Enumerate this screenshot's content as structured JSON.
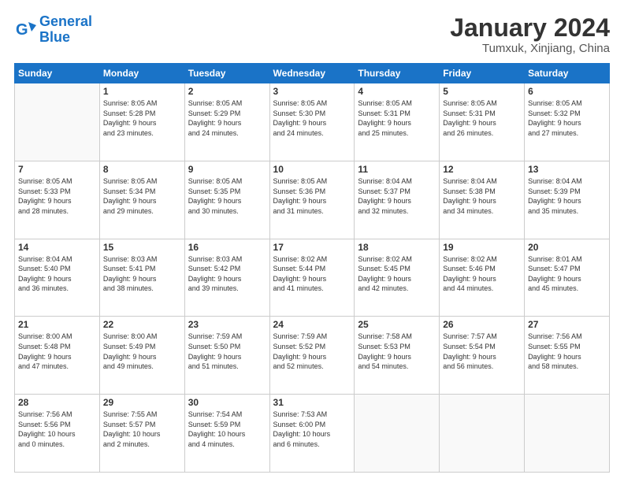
{
  "logo": {
    "line1": "General",
    "line2": "Blue"
  },
  "title": "January 2024",
  "subtitle": "Tumxuk, Xinjiang, China",
  "weekdays": [
    "Sunday",
    "Monday",
    "Tuesday",
    "Wednesday",
    "Thursday",
    "Friday",
    "Saturday"
  ],
  "weeks": [
    [
      {
        "day": "",
        "info": ""
      },
      {
        "day": "1",
        "info": "Sunrise: 8:05 AM\nSunset: 5:28 PM\nDaylight: 9 hours\nand 23 minutes."
      },
      {
        "day": "2",
        "info": "Sunrise: 8:05 AM\nSunset: 5:29 PM\nDaylight: 9 hours\nand 24 minutes."
      },
      {
        "day": "3",
        "info": "Sunrise: 8:05 AM\nSunset: 5:30 PM\nDaylight: 9 hours\nand 24 minutes."
      },
      {
        "day": "4",
        "info": "Sunrise: 8:05 AM\nSunset: 5:31 PM\nDaylight: 9 hours\nand 25 minutes."
      },
      {
        "day": "5",
        "info": "Sunrise: 8:05 AM\nSunset: 5:31 PM\nDaylight: 9 hours\nand 26 minutes."
      },
      {
        "day": "6",
        "info": "Sunrise: 8:05 AM\nSunset: 5:32 PM\nDaylight: 9 hours\nand 27 minutes."
      }
    ],
    [
      {
        "day": "7",
        "info": "Sunrise: 8:05 AM\nSunset: 5:33 PM\nDaylight: 9 hours\nand 28 minutes."
      },
      {
        "day": "8",
        "info": "Sunrise: 8:05 AM\nSunset: 5:34 PM\nDaylight: 9 hours\nand 29 minutes."
      },
      {
        "day": "9",
        "info": "Sunrise: 8:05 AM\nSunset: 5:35 PM\nDaylight: 9 hours\nand 30 minutes."
      },
      {
        "day": "10",
        "info": "Sunrise: 8:05 AM\nSunset: 5:36 PM\nDaylight: 9 hours\nand 31 minutes."
      },
      {
        "day": "11",
        "info": "Sunrise: 8:04 AM\nSunset: 5:37 PM\nDaylight: 9 hours\nand 32 minutes."
      },
      {
        "day": "12",
        "info": "Sunrise: 8:04 AM\nSunset: 5:38 PM\nDaylight: 9 hours\nand 34 minutes."
      },
      {
        "day": "13",
        "info": "Sunrise: 8:04 AM\nSunset: 5:39 PM\nDaylight: 9 hours\nand 35 minutes."
      }
    ],
    [
      {
        "day": "14",
        "info": "Sunrise: 8:04 AM\nSunset: 5:40 PM\nDaylight: 9 hours\nand 36 minutes."
      },
      {
        "day": "15",
        "info": "Sunrise: 8:03 AM\nSunset: 5:41 PM\nDaylight: 9 hours\nand 38 minutes."
      },
      {
        "day": "16",
        "info": "Sunrise: 8:03 AM\nSunset: 5:42 PM\nDaylight: 9 hours\nand 39 minutes."
      },
      {
        "day": "17",
        "info": "Sunrise: 8:02 AM\nSunset: 5:44 PM\nDaylight: 9 hours\nand 41 minutes."
      },
      {
        "day": "18",
        "info": "Sunrise: 8:02 AM\nSunset: 5:45 PM\nDaylight: 9 hours\nand 42 minutes."
      },
      {
        "day": "19",
        "info": "Sunrise: 8:02 AM\nSunset: 5:46 PM\nDaylight: 9 hours\nand 44 minutes."
      },
      {
        "day": "20",
        "info": "Sunrise: 8:01 AM\nSunset: 5:47 PM\nDaylight: 9 hours\nand 45 minutes."
      }
    ],
    [
      {
        "day": "21",
        "info": "Sunrise: 8:00 AM\nSunset: 5:48 PM\nDaylight: 9 hours\nand 47 minutes."
      },
      {
        "day": "22",
        "info": "Sunrise: 8:00 AM\nSunset: 5:49 PM\nDaylight: 9 hours\nand 49 minutes."
      },
      {
        "day": "23",
        "info": "Sunrise: 7:59 AM\nSunset: 5:50 PM\nDaylight: 9 hours\nand 51 minutes."
      },
      {
        "day": "24",
        "info": "Sunrise: 7:59 AM\nSunset: 5:52 PM\nDaylight: 9 hours\nand 52 minutes."
      },
      {
        "day": "25",
        "info": "Sunrise: 7:58 AM\nSunset: 5:53 PM\nDaylight: 9 hours\nand 54 minutes."
      },
      {
        "day": "26",
        "info": "Sunrise: 7:57 AM\nSunset: 5:54 PM\nDaylight: 9 hours\nand 56 minutes."
      },
      {
        "day": "27",
        "info": "Sunrise: 7:56 AM\nSunset: 5:55 PM\nDaylight: 9 hours\nand 58 minutes."
      }
    ],
    [
      {
        "day": "28",
        "info": "Sunrise: 7:56 AM\nSunset: 5:56 PM\nDaylight: 10 hours\nand 0 minutes."
      },
      {
        "day": "29",
        "info": "Sunrise: 7:55 AM\nSunset: 5:57 PM\nDaylight: 10 hours\nand 2 minutes."
      },
      {
        "day": "30",
        "info": "Sunrise: 7:54 AM\nSunset: 5:59 PM\nDaylight: 10 hours\nand 4 minutes."
      },
      {
        "day": "31",
        "info": "Sunrise: 7:53 AM\nSunset: 6:00 PM\nDaylight: 10 hours\nand 6 minutes."
      },
      {
        "day": "",
        "info": ""
      },
      {
        "day": "",
        "info": ""
      },
      {
        "day": "",
        "info": ""
      }
    ]
  ]
}
